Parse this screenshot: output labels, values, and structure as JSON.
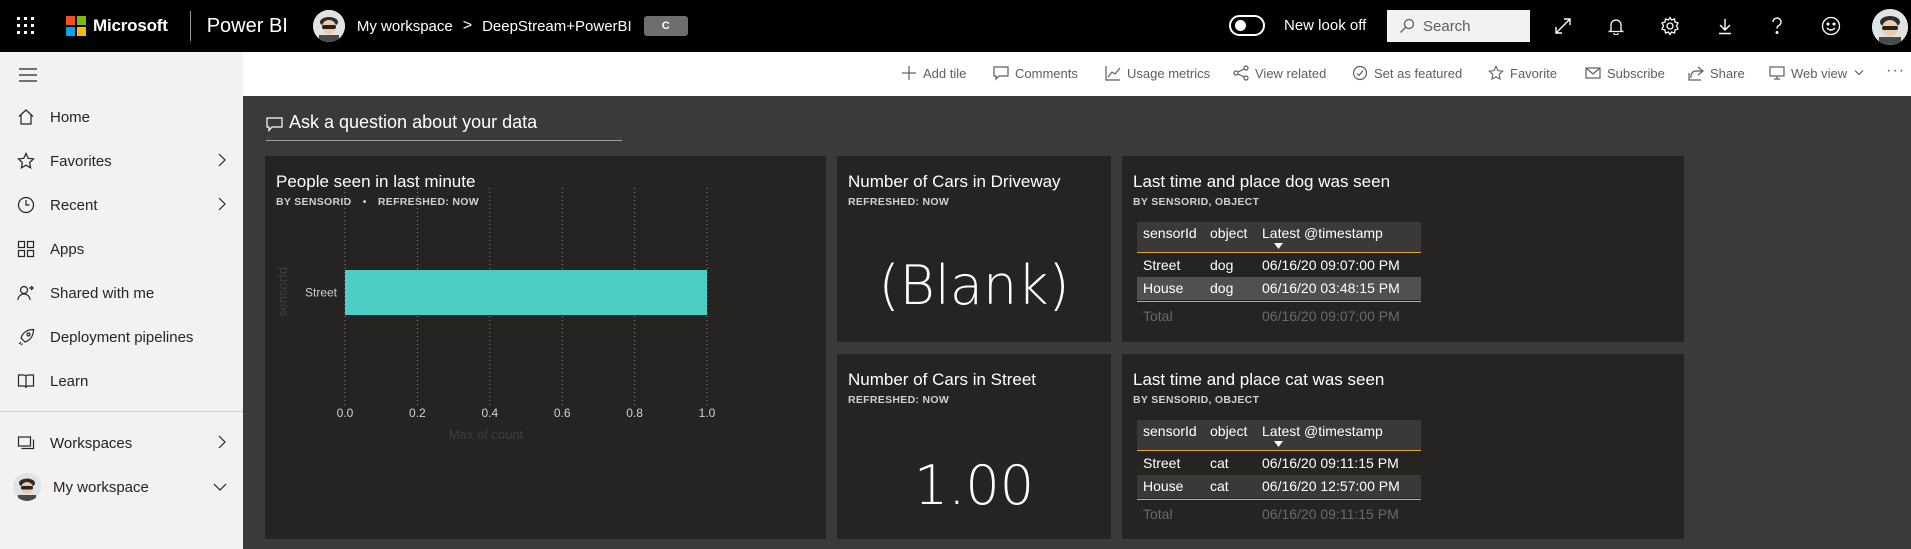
{
  "topbar": {
    "brand": "Microsoft",
    "product": "Power BI",
    "breadcrumb_workspace": "My workspace",
    "breadcrumb_separator": ">",
    "breadcrumb_item": "DeepStream+PowerBI",
    "badge": "C",
    "new_look_label": "New look off",
    "search_placeholder": "Search",
    "icons": [
      "waffle-icon",
      "expand-icon",
      "bell-icon",
      "gear-icon",
      "download-icon",
      "help-icon",
      "feedback-icon"
    ],
    "colors": {
      "background": "#000000",
      "ms_red": "#f25022",
      "ms_green": "#7fba00",
      "ms_blue": "#00a4ef",
      "ms_yellow": "#ffb900"
    }
  },
  "sidebar": {
    "items": [
      {
        "label": "Home",
        "icon": "home-icon"
      },
      {
        "label": "Favorites",
        "icon": "star-icon",
        "expandable": true
      },
      {
        "label": "Recent",
        "icon": "clock-icon",
        "expandable": true
      },
      {
        "label": "Apps",
        "icon": "apps-icon"
      },
      {
        "label": "Shared with me",
        "icon": "shared-icon"
      },
      {
        "label": "Deployment pipelines",
        "icon": "rocket-icon"
      },
      {
        "label": "Learn",
        "icon": "book-icon"
      }
    ],
    "workspaces_label": "Workspaces",
    "my_workspace_label": "My workspace"
  },
  "actionbar": {
    "items": [
      {
        "label": "Add tile",
        "icon": "plus-icon"
      },
      {
        "label": "Comments",
        "icon": "comment-icon"
      },
      {
        "label": "Usage metrics",
        "icon": "usage-icon"
      },
      {
        "label": "View related",
        "icon": "related-icon"
      },
      {
        "label": "Set as featured",
        "icon": "featured-icon"
      },
      {
        "label": "Favorite",
        "icon": "star-icon"
      },
      {
        "label": "Subscribe",
        "icon": "mail-icon"
      },
      {
        "label": "Share",
        "icon": "share-icon"
      },
      {
        "label": "Web view",
        "icon": "web-view-icon"
      }
    ]
  },
  "qna": {
    "placeholder": "Ask a question about your data"
  },
  "tiles": {
    "people": {
      "title": "People seen in last minute",
      "subtitle_by": "BY SENSORID",
      "subtitle_bullet": "•",
      "subtitle_refreshed": "REFRESHED: NOW",
      "ylabel": "sensorId",
      "xlabel": "Max of count"
    },
    "driveway": {
      "title": "Number of Cars in Driveway",
      "subtitle": "REFRESHED: NOW",
      "value": "(Blank)"
    },
    "street": {
      "title": "Number of Cars in Street",
      "subtitle": "REFRESHED: NOW",
      "value": "1.00"
    },
    "dog": {
      "title": "Last time and place dog was seen",
      "subtitle": "BY SENSORID, OBJECT",
      "headers": [
        "sensorId",
        "object",
        "Latest @timestamp"
      ],
      "rows": [
        [
          "Street",
          "dog",
          "06/16/20 09:07:00 PM"
        ],
        [
          "House",
          "dog",
          "06/16/20 03:48:15 PM"
        ]
      ],
      "total_label": "Total",
      "total_value": "06/16/20 09:07:00 PM"
    },
    "cat": {
      "title": "Last time and place cat was seen",
      "subtitle": "BY SENSORID, OBJECT",
      "headers": [
        "sensorId",
        "object",
        "Latest @timestamp"
      ],
      "rows": [
        [
          "Street",
          "cat",
          "06/16/20 09:11:15 PM"
        ],
        [
          "House",
          "cat",
          "06/16/20 12:57:00 PM"
        ]
      ],
      "total_label": "Total",
      "total_value": "06/16/20 09:11:15 PM"
    }
  },
  "chart_data": {
    "type": "bar",
    "orientation": "horizontal",
    "categories": [
      "Street"
    ],
    "values": [
      1.0
    ],
    "xlim": [
      0,
      1
    ],
    "xticks": [
      "0.0",
      "0.2",
      "0.4",
      "0.6",
      "0.8",
      "1.0"
    ],
    "xlabel": "Max of count",
    "ylabel": "sensorId",
    "grid": "vertical dotted",
    "color": "#4ecdc4"
  }
}
